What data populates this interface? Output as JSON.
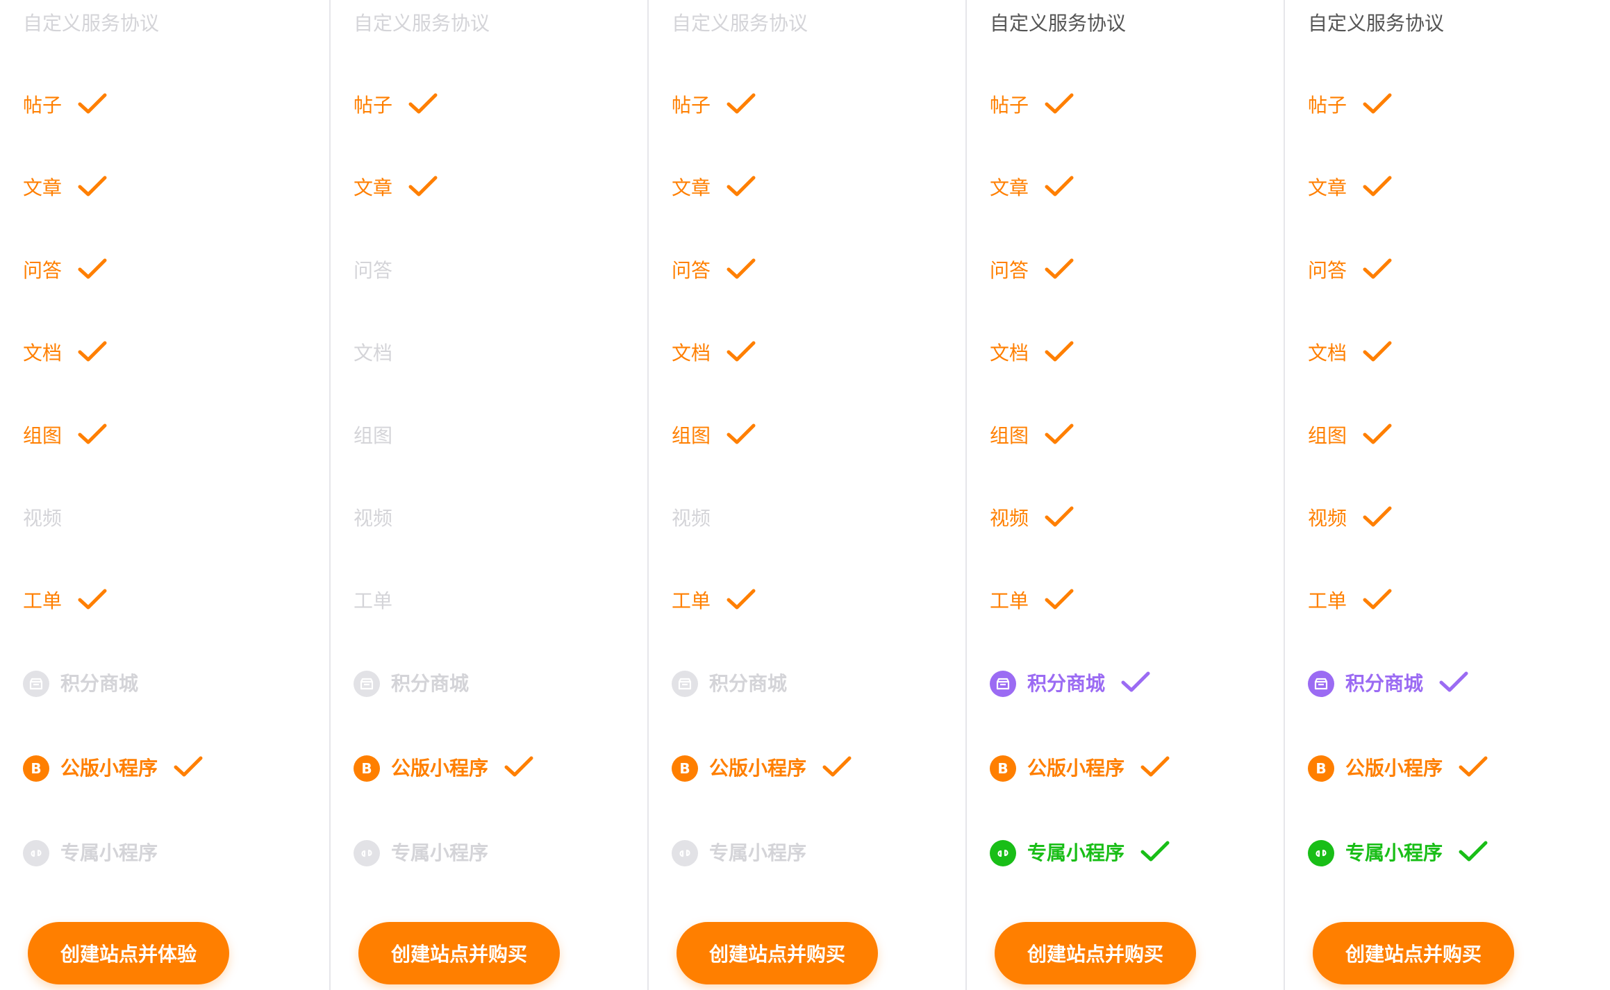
{
  "colors": {
    "accent_orange": "#ff7f00",
    "accent_purple": "#9b6bf3",
    "accent_green": "#19be17",
    "disabled_gray": "#d4d4d8",
    "header_text": "#555555"
  },
  "plans": [
    {
      "header": "自定义服务协议",
      "header_enabled": false,
      "features": [
        {
          "label": "帖子",
          "enabled": true
        },
        {
          "label": "文章",
          "enabled": true
        },
        {
          "label": "问答",
          "enabled": true
        },
        {
          "label": "文档",
          "enabled": true
        },
        {
          "label": "组图",
          "enabled": true
        },
        {
          "label": "视频",
          "enabled": false
        },
        {
          "label": "工单",
          "enabled": true
        },
        {
          "label": "积分商城",
          "enabled": false,
          "icon": "shop-icon"
        },
        {
          "label": "公版小程序",
          "enabled": true,
          "icon": "b-icon"
        },
        {
          "label": "专属小程序",
          "enabled": false,
          "icon": "mini-program-icon"
        }
      ],
      "button": "创建站点并体验"
    },
    {
      "header": "自定义服务协议",
      "header_enabled": false,
      "features": [
        {
          "label": "帖子",
          "enabled": true
        },
        {
          "label": "文章",
          "enabled": true
        },
        {
          "label": "问答",
          "enabled": false
        },
        {
          "label": "文档",
          "enabled": false
        },
        {
          "label": "组图",
          "enabled": false
        },
        {
          "label": "视频",
          "enabled": false
        },
        {
          "label": "工单",
          "enabled": false
        },
        {
          "label": "积分商城",
          "enabled": false,
          "icon": "shop-icon"
        },
        {
          "label": "公版小程序",
          "enabled": true,
          "icon": "b-icon"
        },
        {
          "label": "专属小程序",
          "enabled": false,
          "icon": "mini-program-icon"
        }
      ],
      "button": "创建站点并购买"
    },
    {
      "header": "自定义服务协议",
      "header_enabled": false,
      "features": [
        {
          "label": "帖子",
          "enabled": true
        },
        {
          "label": "文章",
          "enabled": true
        },
        {
          "label": "问答",
          "enabled": true
        },
        {
          "label": "文档",
          "enabled": true
        },
        {
          "label": "组图",
          "enabled": true
        },
        {
          "label": "视频",
          "enabled": false
        },
        {
          "label": "工单",
          "enabled": true
        },
        {
          "label": "积分商城",
          "enabled": false,
          "icon": "shop-icon"
        },
        {
          "label": "公版小程序",
          "enabled": true,
          "icon": "b-icon"
        },
        {
          "label": "专属小程序",
          "enabled": false,
          "icon": "mini-program-icon"
        }
      ],
      "button": "创建站点并购买"
    },
    {
      "header": "自定义服务协议",
      "header_enabled": true,
      "features": [
        {
          "label": "帖子",
          "enabled": true
        },
        {
          "label": "文章",
          "enabled": true
        },
        {
          "label": "问答",
          "enabled": true
        },
        {
          "label": "文档",
          "enabled": true
        },
        {
          "label": "组图",
          "enabled": true
        },
        {
          "label": "视频",
          "enabled": true
        },
        {
          "label": "工单",
          "enabled": true
        },
        {
          "label": "积分商城",
          "enabled": true,
          "icon": "shop-icon",
          "color": "purple"
        },
        {
          "label": "公版小程序",
          "enabled": true,
          "icon": "b-icon"
        },
        {
          "label": "专属小程序",
          "enabled": true,
          "icon": "mini-program-icon",
          "color": "green"
        }
      ],
      "button": "创建站点并购买"
    },
    {
      "header": "自定义服务协议",
      "header_enabled": true,
      "features": [
        {
          "label": "帖子",
          "enabled": true
        },
        {
          "label": "文章",
          "enabled": true
        },
        {
          "label": "问答",
          "enabled": true
        },
        {
          "label": "文档",
          "enabled": true
        },
        {
          "label": "组图",
          "enabled": true
        },
        {
          "label": "视频",
          "enabled": true
        },
        {
          "label": "工单",
          "enabled": true
        },
        {
          "label": "积分商城",
          "enabled": true,
          "icon": "shop-icon",
          "color": "purple"
        },
        {
          "label": "公版小程序",
          "enabled": true,
          "icon": "b-icon"
        },
        {
          "label": "专属小程序",
          "enabled": true,
          "icon": "mini-program-icon",
          "color": "green"
        }
      ],
      "button": "创建站点并购买"
    }
  ]
}
